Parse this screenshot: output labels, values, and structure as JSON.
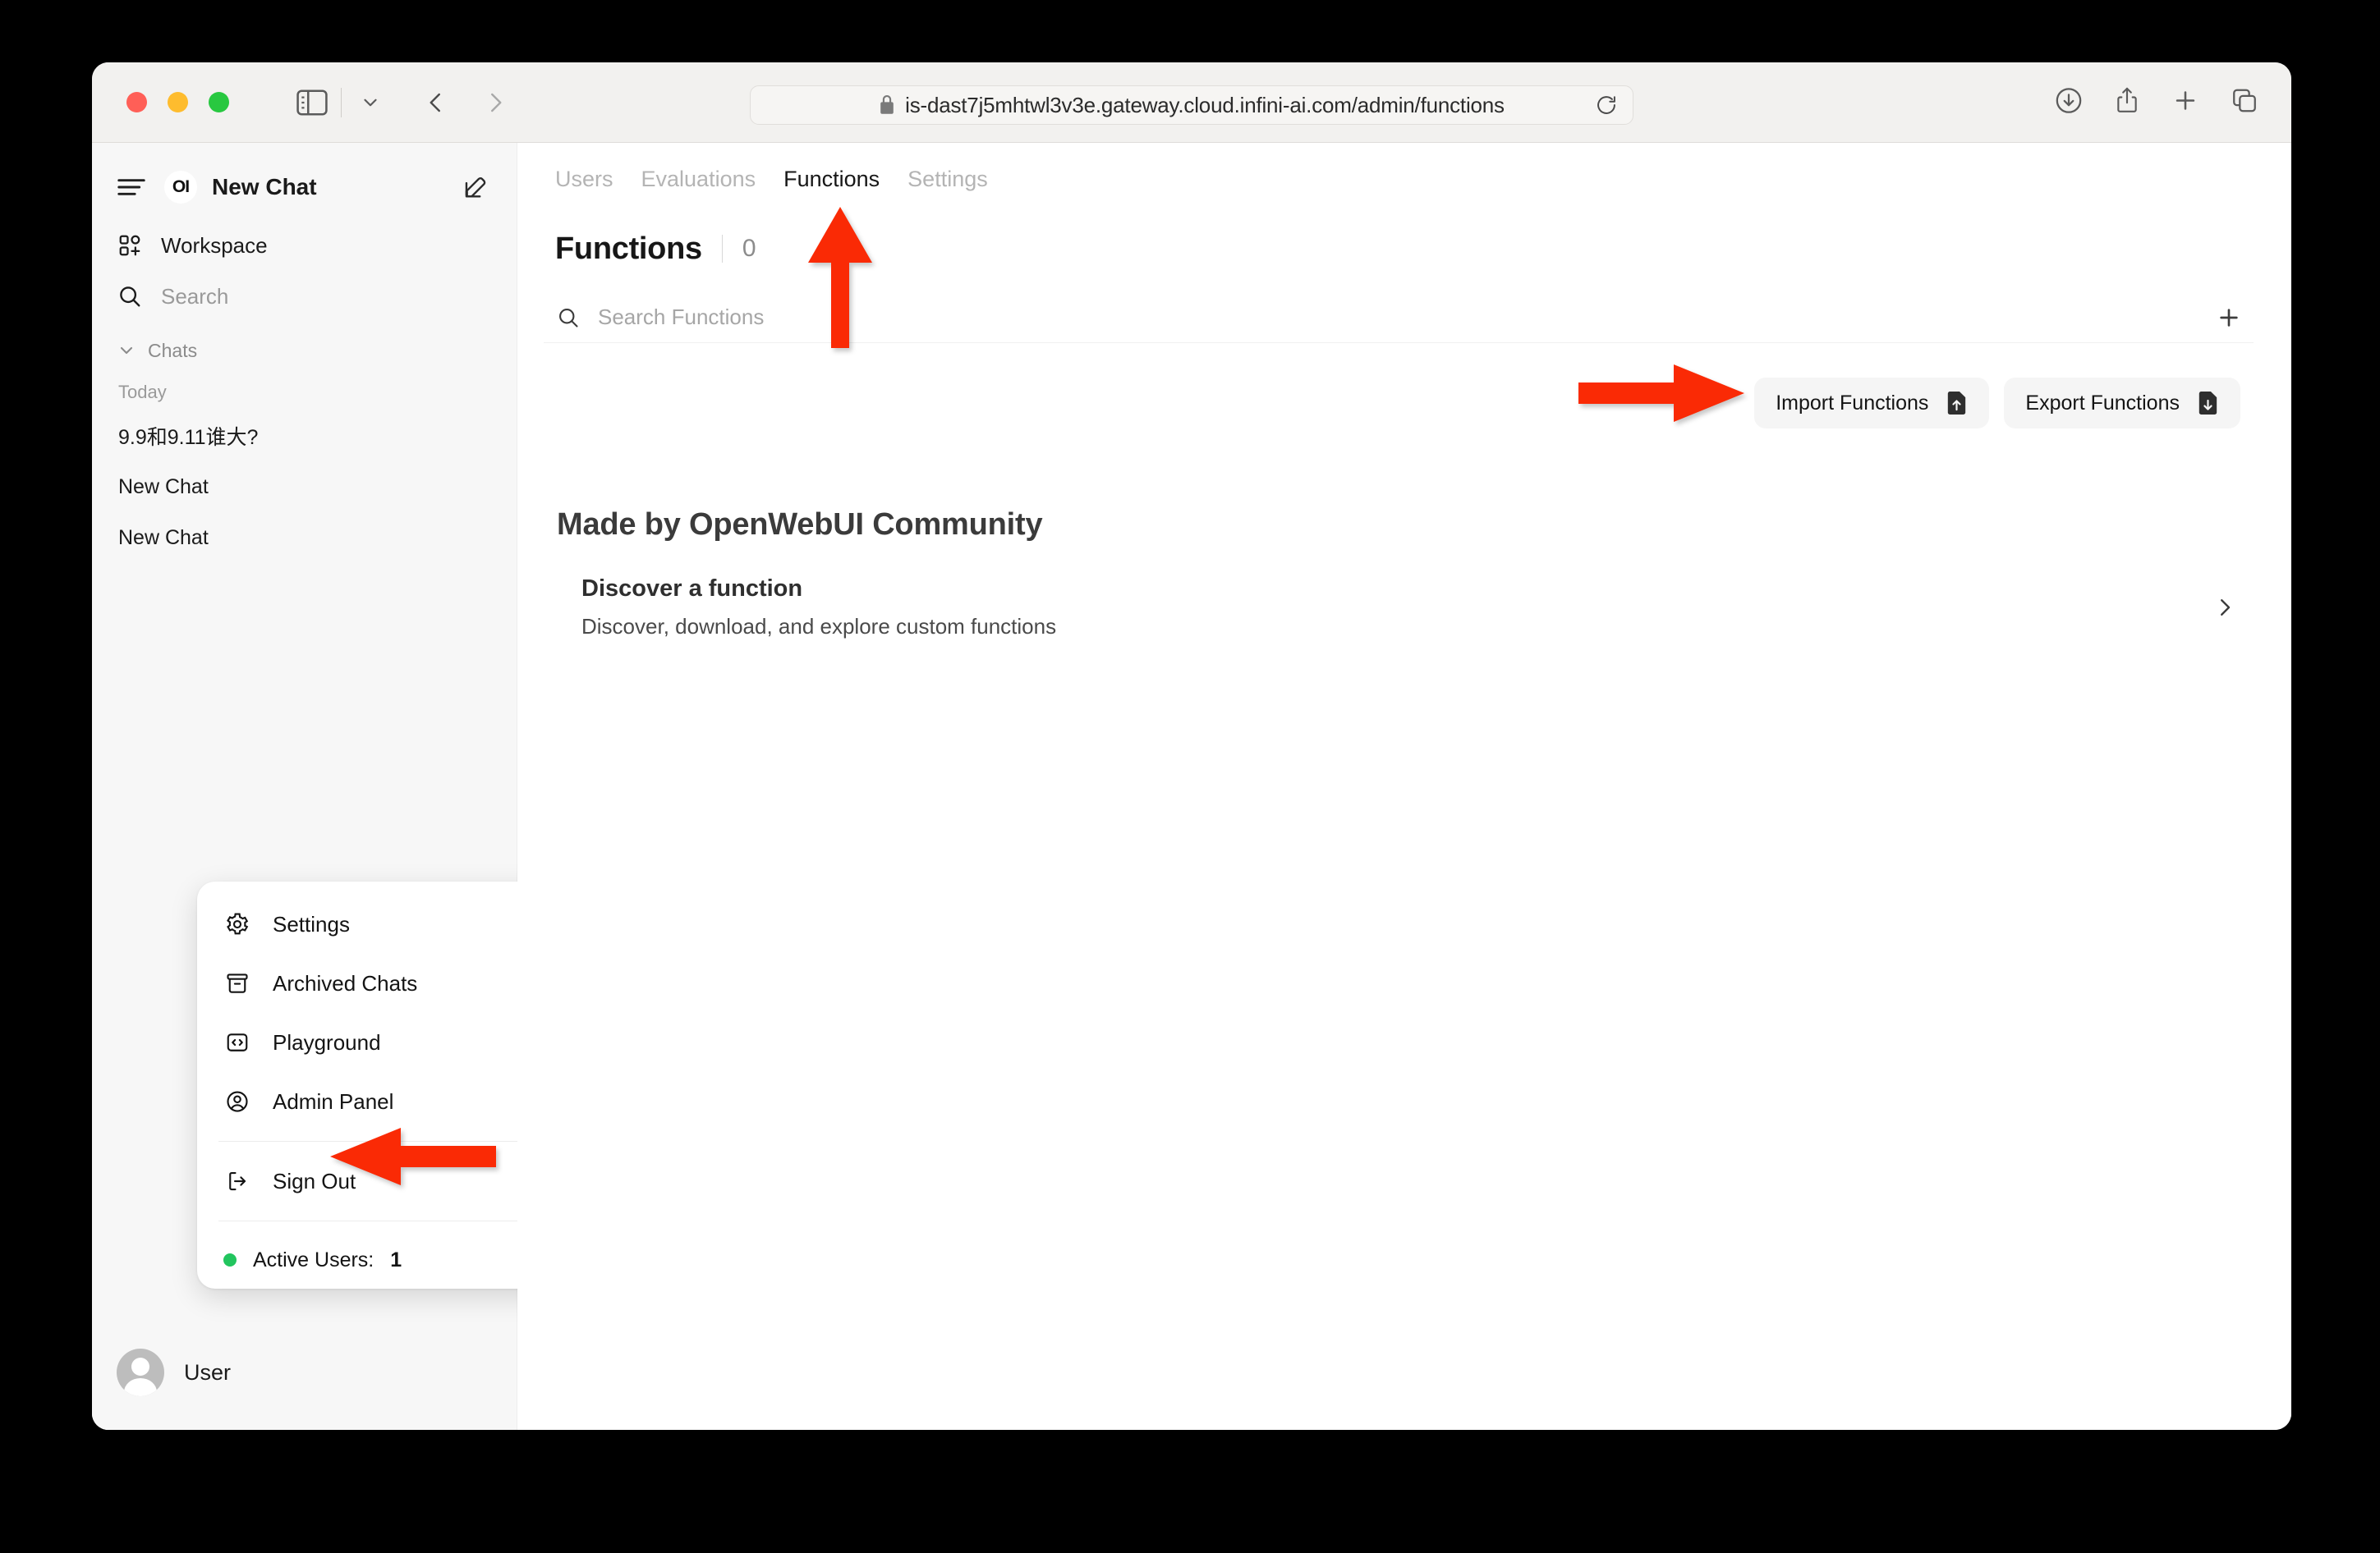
{
  "browser": {
    "url": "is-dast7j5mhtwl3v3e.gateway.cloud.infini-ai.com/admin/functions",
    "icons": {
      "sidebar_toggle": "sidebar-toggle-icon",
      "tab_dropdown": "chevron-down-icon",
      "back": "back-arrow-icon",
      "forward": "forward-arrow-icon",
      "lock": "lock-icon",
      "reload": "reload-icon",
      "downloads": "downloads-icon",
      "share": "share-icon",
      "new_tab": "plus-icon",
      "tab_overview": "tab-overview-icon"
    }
  },
  "sidebar": {
    "logo_text": "OI",
    "title": "New Chat",
    "workspace_label": "Workspace",
    "search_placeholder": "Search",
    "chats_section_label": "Chats",
    "day_label": "Today",
    "chats": [
      {
        "title": "9.9和9.11谁大?"
      },
      {
        "title": "New Chat"
      },
      {
        "title": "New Chat"
      }
    ],
    "user_menu": {
      "items": [
        {
          "label": "Settings",
          "icon": "gear-icon"
        },
        {
          "label": "Archived Chats",
          "icon": "archive-icon"
        },
        {
          "label": "Playground",
          "icon": "code-brackets-icon"
        },
        {
          "label": "Admin Panel",
          "icon": "user-circle-icon"
        }
      ],
      "sign_out_label": "Sign Out",
      "sign_out_icon": "sign-out-icon",
      "active_users_label": "Active Users:",
      "active_users_count": "1"
    },
    "user_name": "User"
  },
  "main": {
    "tabs": [
      {
        "label": "Users",
        "active": false
      },
      {
        "label": "Evaluations",
        "active": false
      },
      {
        "label": "Functions",
        "active": true
      },
      {
        "label": "Settings",
        "active": false
      }
    ],
    "page_title": "Functions",
    "page_count": "0",
    "search_placeholder": "Search Functions",
    "add_button_icon": "plus-icon",
    "import_label": "Import Functions",
    "export_label": "Export Functions",
    "community_heading": "Made by OpenWebUI Community",
    "discover_title": "Discover a function",
    "discover_subtitle": "Discover, download, and explore custom functions",
    "chevron_icon": "chevron-right-icon"
  },
  "annotations": {
    "color": "#fa2a05",
    "arrows": [
      {
        "name": "arrow-up-functions-tab",
        "direction": "up"
      },
      {
        "name": "arrow-right-import-functions",
        "direction": "right"
      },
      {
        "name": "arrow-left-admin-panel",
        "direction": "left"
      }
    ]
  }
}
